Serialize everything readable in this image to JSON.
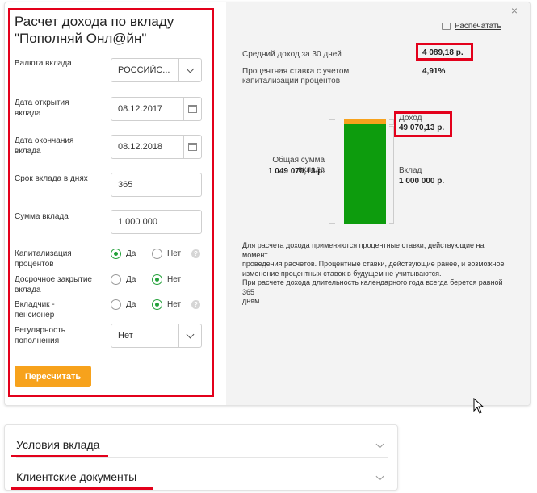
{
  "calculator": {
    "title_line1": "Расчет дохода по вкладу",
    "title_line2": "\"Пополняй Онл@йн\"",
    "currency_label": "Валюта вклада",
    "currency_value": "РОССИЙС...",
    "open_date_label_1": "Дата открытия",
    "open_date_label_2": "вклада",
    "open_date_value": "08.12.2017",
    "close_date_label_1": "Дата окончания",
    "close_date_label_2": "вклада",
    "close_date_value": "08.12.2018",
    "term_label": "Срок вклада в днях",
    "term_value": "365",
    "amount_label": "Сумма вклада",
    "amount_value": "1 000 000",
    "capitalization_label_1": "Капитализация",
    "capitalization_label_2": "процентов",
    "early_close_label_1": "Досрочное закрытие",
    "early_close_label_2": "вклада",
    "pensioner_label_1": "Вкладчик -",
    "pensioner_label_2": "пенсионер",
    "regularity_label_1": "Регулярность",
    "regularity_label_2": "пополнения",
    "regularity_value": "Нет",
    "yes": "Да",
    "no": "Нет",
    "help": "?",
    "recalc_button": "Пересчитать"
  },
  "options": {
    "capitalization": "Да",
    "early_close": "Нет",
    "pensioner": "Нет"
  },
  "result": {
    "close": "×",
    "print_label": "Распечатать",
    "avg_income_label": "Средний доход за 30 дней",
    "avg_income_value": "4 089,18 р.",
    "rate_label_1": "Процентная ставка с учетом",
    "rate_label_2": "капитализации процентов",
    "rate_value": "4,91%",
    "total_label": "Общая сумма вклада",
    "total_value": "1 049 070,13 р.",
    "income_label": "Доход",
    "income_value": "49 070,13 р.",
    "deposit_label": "Вклад",
    "deposit_value": "1 000 000 р.",
    "note_1": "Для расчета дохода применяются процентные ставки, действующие на момент",
    "note_2": "проведения расчетов. Процентные ставки, действующие ранее, и возможное",
    "note_3": "изменение процентных ставок в будущем не учитываются.",
    "note_4": "При расчете дохода длительность календарного года всегда берется равной 365",
    "note_5": "дням."
  },
  "accordion": {
    "conditions": "Условия вклада",
    "documents": "Клиентские документы"
  },
  "colors": {
    "accent_green": "#21a038",
    "bar_deposit": "#0d9c0d",
    "bar_income": "#f7a21c",
    "button": "#f7a21c",
    "highlight": "#e3001b"
  }
}
